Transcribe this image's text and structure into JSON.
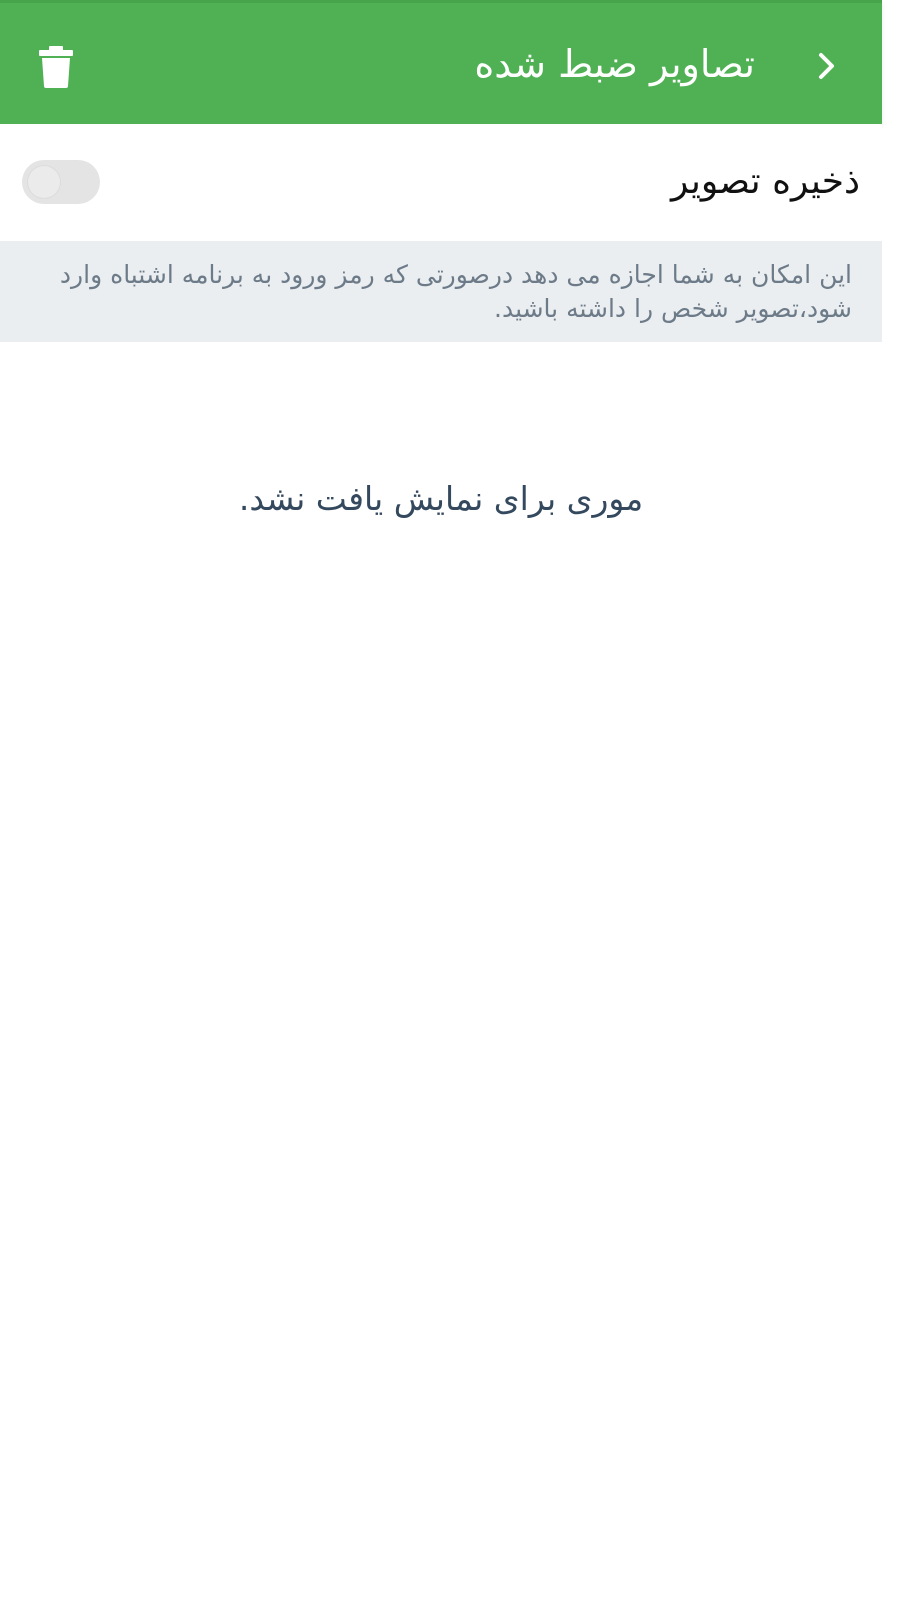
{
  "header": {
    "title": "تصاویر ضبط شده",
    "back_icon": "chevron-right-icon",
    "delete_icon": "trash-icon",
    "background_color": "#4fb153"
  },
  "settings": {
    "save_image_label": "ذخیره تصویر",
    "save_image_enabled": false
  },
  "info": {
    "text": "این امکان به شما اجازه می دهد درصورتی که رمز ورود به برنامه اشتباه وارد شود،تصویر شخص را داشته باشید."
  },
  "empty_state": {
    "message": "موری برای نمایش یافت نشد."
  }
}
